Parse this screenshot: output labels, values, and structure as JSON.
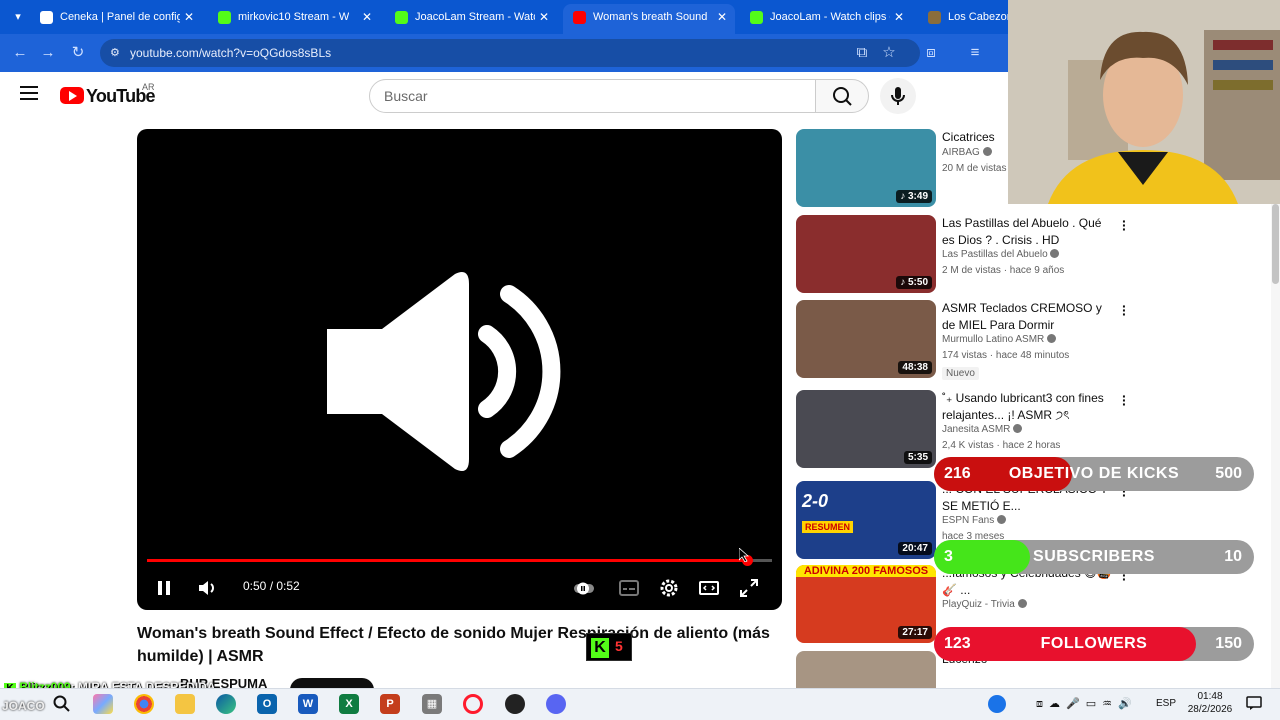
{
  "browser": {
    "tabs": [
      {
        "label": "Ceneka | Panel de configur",
        "favicon_color": "#ffffff"
      },
      {
        "label": "mirkovic10 Stream - W",
        "favicon_color": "#53fc18"
      },
      {
        "label": "JoacoLam Stream - Watch",
        "favicon_color": "#53fc18"
      },
      {
        "label": "Woman's breath Sound",
        "favicon_color": "#ff0000"
      },
      {
        "label": "JoacoLam - Watch clips on",
        "favicon_color": "#53fc18"
      },
      {
        "label": "Los Cabezone",
        "favicon_color": "#8a6d3b"
      }
    ],
    "url": "youtube.com/watch?v=oQGdos8sBLs",
    "tab_close_glyph": "✕"
  },
  "youtube": {
    "logo_text": "YouTube",
    "country": "AR",
    "search_placeholder": "Buscar"
  },
  "player": {
    "time": "0:50 / 0:52",
    "progress": 0.96,
    "title": "Woman's breath Sound Effect / Efecto de sonido Mujer Respiración de aliento (más humilde) | ASMR",
    "channel_partial": "BUR ESPUMA"
  },
  "recommendations": [
    {
      "title": "Cicatrices",
      "channel": "AIRBAG",
      "meta": "20 M de vistas",
      "duration": "3:49",
      "thumb_color": "#3b8fa6",
      "music": true,
      "badge": ""
    },
    {
      "title": "Las Pastillas del Abuelo . Qué es Dios ? . Crisis . HD",
      "channel": "Las Pastillas del Abuelo",
      "meta": "2 M de vistas · hace 9 años",
      "duration": "5:50",
      "thumb_color": "#8a2d2d",
      "music": true,
      "badge": ""
    },
    {
      "title": "ASMR Teclados CREMOSO y de MIEL Para Dormir",
      "channel": "Murmullo Latino ASMR",
      "meta": "174 vistas · hace 48 minutos",
      "duration": "48:38",
      "thumb_color": "#7a5a48",
      "music": false,
      "badge": "Nuevo"
    },
    {
      "title": "˚₊ Usando lubricant3 con fines relajantes... ¡! ASMR ੭ৎ",
      "channel": "Janesita ASMR",
      "meta": "2,4 K vistas · hace 2 horas",
      "duration": "5:35",
      "thumb_color": "#4a4a52",
      "music": false,
      "badge": ""
    },
    {
      "title": "... CON EL SUPERCLÁSICO Y SE METIÓ E...",
      "channel": "ESPN Fans",
      "meta": "hace 3 meses",
      "duration": "20:47",
      "thumb_color": "#1d3f8a",
      "music": false,
      "badge": ""
    },
    {
      "title": "...famosos y Celebridades 😄🤬🎸 ...",
      "channel": "PlayQuiz - Trivia",
      "meta": "",
      "duration": "27:17",
      "thumb_color": "#d63b1f",
      "music": false,
      "badge": ""
    },
    {
      "title": "Lucenzo",
      "channel": "",
      "meta": "",
      "duration": "",
      "thumb_color": "#a79583",
      "music": false,
      "badge": ""
    }
  ],
  "thumb_text": {
    "espn_score": "2-0",
    "espn_resumen": "RESUMEN",
    "adivina": "ADIVINA 200 FAMOSOS",
    "k_badge": "5"
  },
  "overlays": {
    "kicks": {
      "current": "216",
      "label": "OBJETIVO DE KICKS",
      "target": "500",
      "fraction": 0.43,
      "color": "#c90f0f"
    },
    "subscribers": {
      "current": "3",
      "label": "SUBSCRIBERS",
      "target": "10",
      "fraction": 0.3,
      "color": "#45e51a"
    },
    "followers": {
      "current": "123",
      "label": "FOLLOWERS",
      "target": "150",
      "fraction": 0.82,
      "color": "#e8112d"
    }
  },
  "chat": {
    "user": "Blitzz009",
    "message": ": MIRA ESTA DESPEDIDA",
    "streamer_tag": "JOACO"
  },
  "taskbar": {
    "language": "ESP",
    "time": "01:48",
    "date": "28/2/2026"
  }
}
